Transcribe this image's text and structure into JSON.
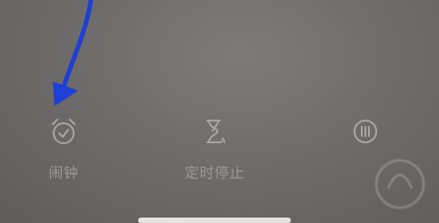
{
  "quick_actions": [
    {
      "id": "alarm",
      "label": "闹钟",
      "icon": "alarm-clock-icon"
    },
    {
      "id": "timer",
      "label": "定时停止",
      "icon": "hourglass-icon"
    },
    {
      "id": "more",
      "label": "",
      "icon": "pause-circle-icon"
    }
  ],
  "colors": {
    "background": "#6f6d6b",
    "icon": "#a8a6a4",
    "label": "#9a9896",
    "annotation_arrow": "#1f3fd6",
    "home_indicator": "#e6e4e2"
  },
  "annotation": {
    "type": "arrow",
    "points_to": "alarm"
  }
}
